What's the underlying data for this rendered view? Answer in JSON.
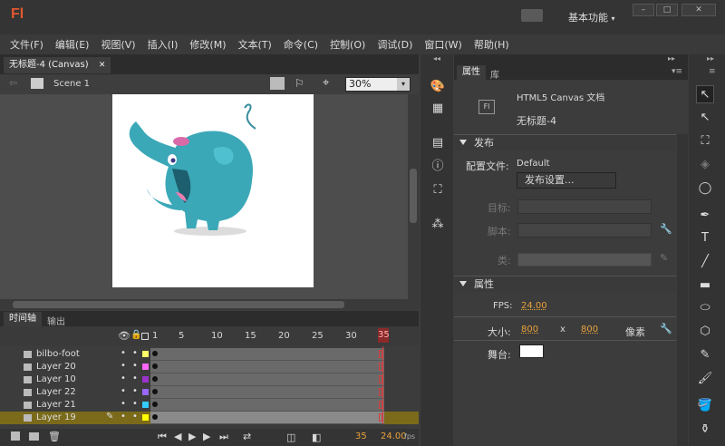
{
  "app": {
    "logo": "Fl",
    "workspace": "基本功能"
  },
  "menu": [
    "文件(F)",
    "编辑(E)",
    "视图(V)",
    "插入(I)",
    "修改(M)",
    "文本(T)",
    "命令(C)",
    "控制(O)",
    "调试(D)",
    "窗口(W)",
    "帮助(H)"
  ],
  "document": {
    "tab": "无标题-4 (Canvas)",
    "scene": "Scene 1",
    "zoom": "30%"
  },
  "timeline": {
    "tabs": [
      "时间轴",
      "输出"
    ],
    "frame_numbers": [
      "1",
      "5",
      "10",
      "15",
      "20",
      "25",
      "30",
      "35"
    ],
    "current_frame": "35",
    "layers": [
      "bilbo-foot",
      "Layer 20",
      "Layer 10",
      "Layer 22",
      "Layer 21",
      "Layer 19"
    ],
    "layer_colors": [
      "#ffff66",
      "#ff66ff",
      "#9933cc",
      "#9966ff",
      "#33ccff",
      "#ffff00"
    ],
    "status_frame": "35",
    "status_fps": "24.00",
    "fps_unit": "fps"
  },
  "properties": {
    "tabs": [
      "属性",
      "库"
    ],
    "doc_type": "HTML5 Canvas 文档",
    "doc_name": "无标题-4",
    "publish_section": "发布",
    "profile_label": "配置文件:",
    "profile_value": "Default",
    "publish_settings_btn": "发布设置...",
    "target_label": "目标:",
    "script_label": "脚本:",
    "class_label": "类:",
    "props_section": "属性",
    "fps_label": "FPS:",
    "fps_value": "24.00",
    "size_label": "大小:",
    "width": "800",
    "x": "x",
    "height": "800",
    "px_unit": "像素",
    "stage_label": "舞台:"
  }
}
